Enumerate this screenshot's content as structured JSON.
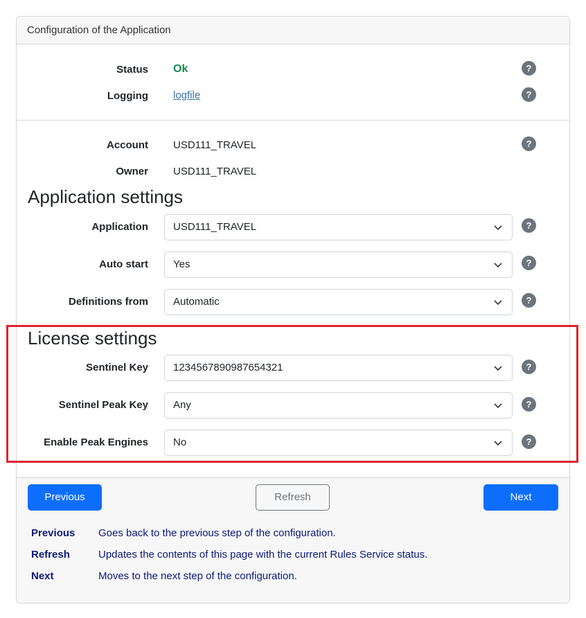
{
  "header": {
    "title": "Configuration of the Application"
  },
  "status": {
    "status_label": "Status",
    "status_value": "Ok",
    "logging_label": "Logging",
    "logging_value": "logfile"
  },
  "account": {
    "account_label": "Account",
    "account_value": "USD111_TRAVEL",
    "owner_label": "Owner",
    "owner_value": "USD111_TRAVEL"
  },
  "application_settings": {
    "title": "Application settings",
    "application_label": "Application",
    "application_value": "USD111_TRAVEL",
    "auto_start_label": "Auto start",
    "auto_start_value": "Yes",
    "definitions_label": "Definitions from",
    "definitions_value": "Automatic"
  },
  "license_settings": {
    "title": "License settings",
    "sentinel_key_label": "Sentinel Key",
    "sentinel_key_value": "1234567890987654321",
    "peak_key_label": "Sentinel Peak Key",
    "peak_key_value": "Any",
    "peak_engines_label": "Enable Peak Engines",
    "peak_engines_value": "No"
  },
  "help_glyph": "?",
  "buttons": {
    "previous": "Previous",
    "refresh": "Refresh",
    "next": "Next"
  },
  "legend": [
    {
      "term": "Previous",
      "desc": "Goes back to the previous step of the configuration."
    },
    {
      "term": "Refresh",
      "desc": "Updates the contents of this page with the current Rules Service status."
    },
    {
      "term": "Next",
      "desc": "Moves to the next step of the configuration."
    }
  ],
  "colors": {
    "primary": "#0d6efd",
    "ok": "#198754",
    "link": "#3c6ea8",
    "help": "#6c757d",
    "highlight": "#e0232e",
    "legend_text": "#0a1a7a"
  },
  "icons": {
    "help": "question-circle-icon",
    "dropdown": "chevron-down-icon"
  }
}
